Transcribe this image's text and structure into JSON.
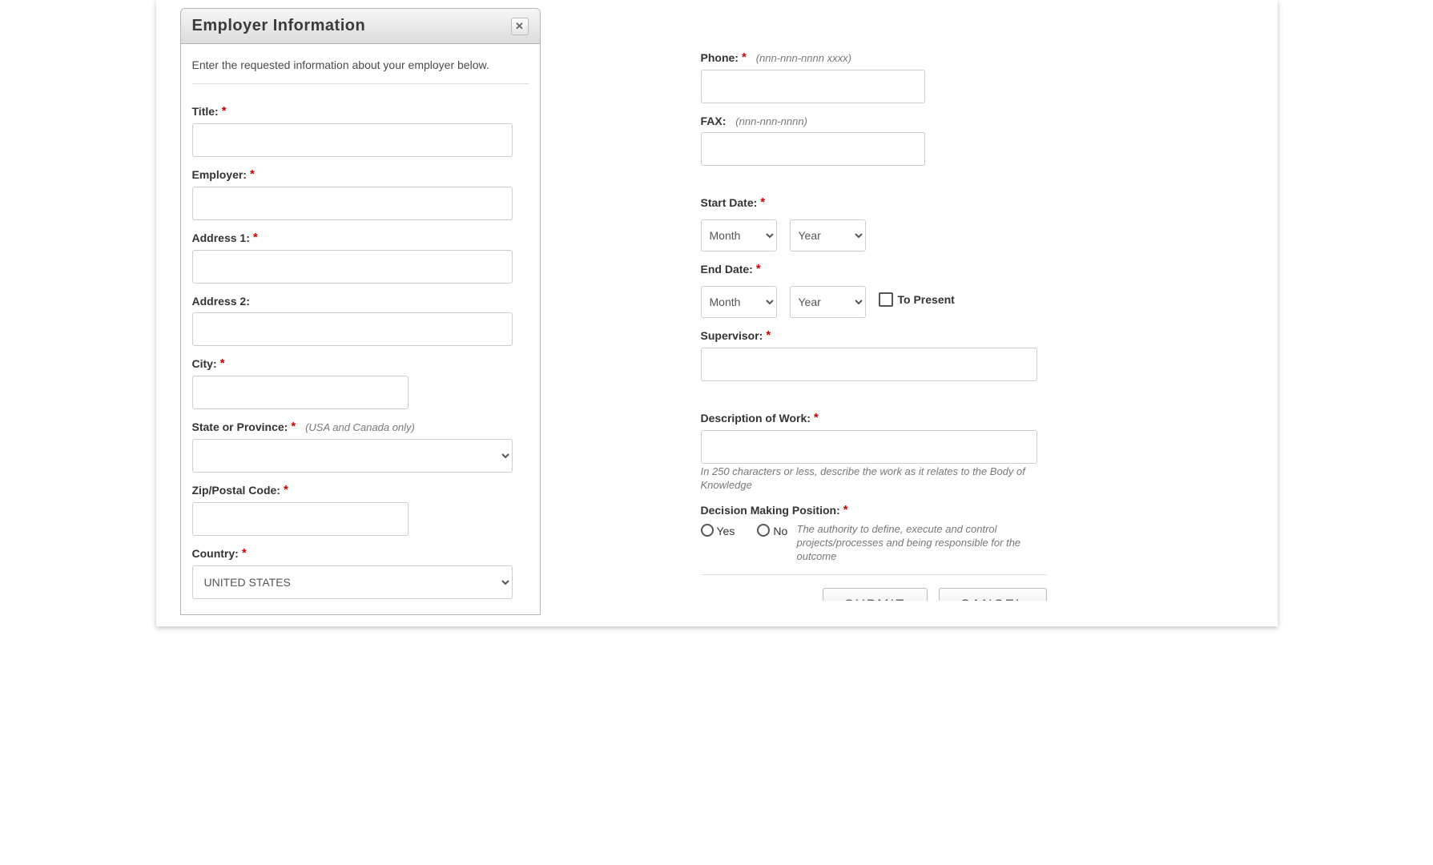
{
  "dialog": {
    "title": "Employer Information",
    "intro": "Enter the requested information about your employer below."
  },
  "left": {
    "title_label": "Title:",
    "employer_label": "Employer:",
    "address1_label": "Address 1:",
    "address2_label": "Address 2:",
    "city_label": "City:",
    "state_label": "State or Province:",
    "state_hint": "(USA and Canada only)",
    "zip_label": "Zip/Postal Code:",
    "country_label": "Country:",
    "country_value": "UNITED STATES"
  },
  "right": {
    "phone_label": "Phone:",
    "phone_hint": "(nnn-nnn-nnnn xxxx)",
    "fax_label": "FAX:",
    "fax_hint": "(nnn-nnn-nnnn)",
    "start_label": "Start Date:",
    "end_label": "End Date:",
    "month_option": "Month",
    "year_option": "Year",
    "to_present": "To Present",
    "supervisor_label": "Supervisor:",
    "desc_label": "Description of Work:",
    "desc_help": "In 250 characters or less, describe the work as it relates to the Body of Knowledge",
    "decision_label": "Decision Making Position:",
    "yes": "Yes",
    "no": "No",
    "decision_help": "The authority to define, execute and control projects/processes and being responsible for the outcome"
  },
  "buttons": {
    "submit": "SUBMIT",
    "cancel": "CANCEL"
  }
}
